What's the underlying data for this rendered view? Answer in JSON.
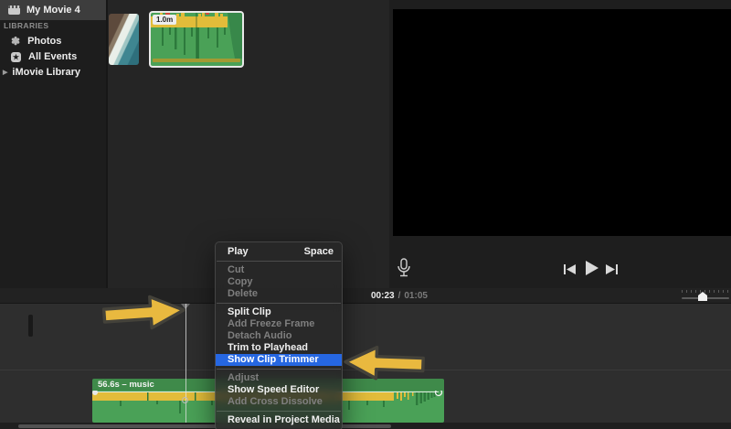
{
  "sidebar": {
    "project_name": "My Movie 4",
    "libraries_header": "LIBRARIES",
    "items": [
      {
        "label": "Photos"
      },
      {
        "label": "All Events"
      },
      {
        "label": "iMovie Library"
      }
    ],
    "glyphs": {
      "pinwheel": "✽",
      "star": "★",
      "disclosure": "▶"
    }
  },
  "media_browser": {
    "selected_clip_badge": "1.0m"
  },
  "preview": {
    "current_time": "00:23",
    "separator": "/",
    "total_time": "01:05"
  },
  "context_menu": {
    "items": [
      {
        "label": "Play",
        "shortcut": "Space",
        "state": "enabled"
      },
      {
        "label": "Cut",
        "state": "disabled"
      },
      {
        "label": "Copy",
        "state": "disabled"
      },
      {
        "label": "Delete",
        "state": "disabled"
      },
      {
        "label": "Split Clip",
        "state": "enabled"
      },
      {
        "label": "Add Freeze Frame",
        "state": "disabled"
      },
      {
        "label": "Detach Audio",
        "state": "disabled"
      },
      {
        "label": "Trim to Playhead",
        "state": "enabled"
      },
      {
        "label": "Show Clip Trimmer",
        "state": "highlighted"
      },
      {
        "label": "Adjust",
        "state": "disabled"
      },
      {
        "label": "Show Speed Editor",
        "state": "enabled"
      },
      {
        "label": "Add Cross Dissolve",
        "state": "disabled"
      },
      {
        "label": "Reveal in Project Media",
        "state": "enabled"
      }
    ]
  },
  "timeline": {
    "music_clip_label": "56.6s – music"
  },
  "colors": {
    "menu_highlight": "#2667e2",
    "clip_green": "#4aa157",
    "waveform_yellow": "#e2bc3a",
    "annotation_arrow": "#e9b93f"
  }
}
